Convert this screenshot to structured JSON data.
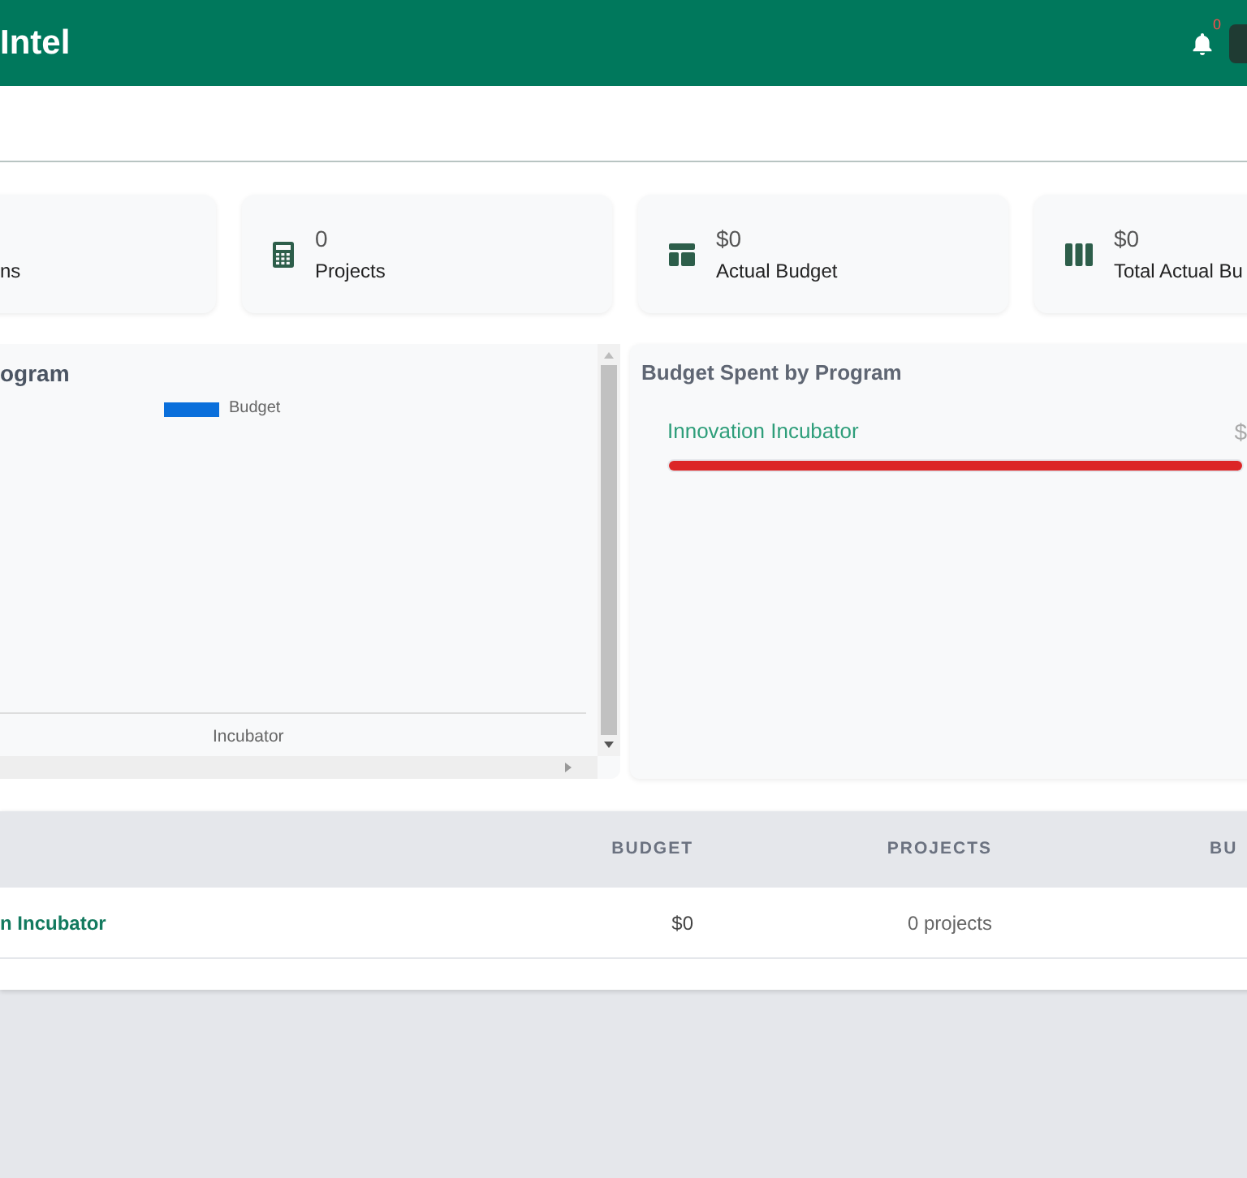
{
  "header": {
    "title": "Intel",
    "notifications": {
      "count": "0"
    }
  },
  "stats": [
    {
      "label": "ns"
    },
    {
      "value": "0",
      "label": "Projects"
    },
    {
      "value": "$0",
      "label": "Actual Budget"
    },
    {
      "value": "$0",
      "label": "Total Actual Bu"
    }
  ],
  "budget_chart": {
    "title": "ogram",
    "legend": "Budget",
    "category": "Incubator"
  },
  "budget_spent": {
    "title": "Budget Spent by Program",
    "items": [
      {
        "name": "Innovation Incubator",
        "amount": "$",
        "level": 1
      }
    ]
  },
  "table": {
    "columns": [
      "BUDGET",
      "PROJECTS",
      "BU"
    ],
    "rows": [
      {
        "name": "n Incubator",
        "budget": "$0",
        "projects": "0 projects"
      }
    ]
  }
}
